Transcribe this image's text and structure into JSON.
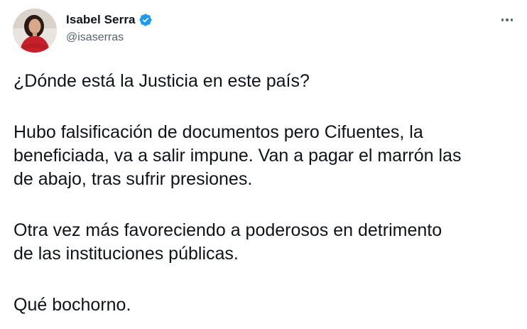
{
  "author": {
    "display_name": "Isabel Serra",
    "handle": "@isaserras",
    "verified": true
  },
  "tweet": {
    "paragraphs": [
      [
        "¿Dónde está la Justicia en este país?"
      ],
      [
        "Hubo falsificación de documentos pero Cifuentes, la",
        "beneficiada, va a salir impune. Van a pagar el marrón las",
        "de abajo, tras sufrir presiones."
      ],
      [
        "Otra vez más favoreciendo a poderosos en detrimento",
        "de las instituciones públicas."
      ],
      [
        "Qué bochorno."
      ]
    ]
  },
  "icons": {
    "verified": "verified-badge-icon",
    "more": "more-options-icon"
  },
  "colors": {
    "text": "#0f1419",
    "secondary": "#536471",
    "verified": "#1d9bf0"
  }
}
